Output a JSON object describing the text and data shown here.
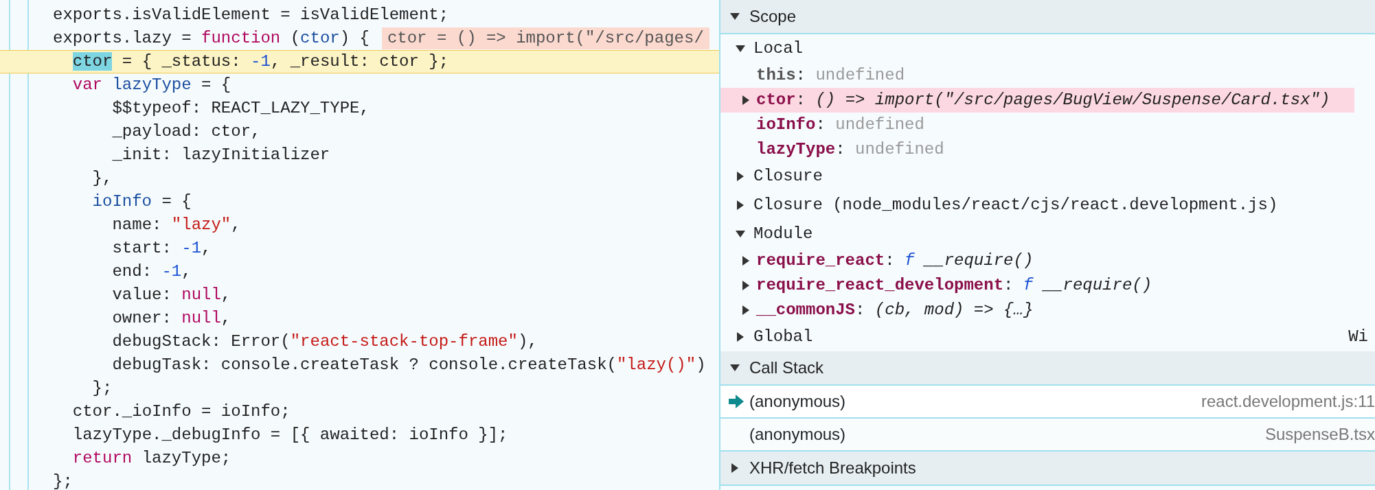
{
  "code": {
    "lines": [
      {
        "current": false,
        "segments": [
          {
            "kind": "plain",
            "text": "exports.isValidElement = isValidElement;"
          }
        ]
      },
      {
        "current": false,
        "segments": [
          {
            "kind": "plain",
            "text": "exports.lazy = "
          },
          {
            "kind": "keyword",
            "text": "function"
          },
          {
            "kind": "plain",
            "text": " ("
          },
          {
            "kind": "def",
            "text": "ctor"
          },
          {
            "kind": "plain",
            "text": ") {"
          }
        ],
        "inline_value": "ctor = () => import(\"/src/pages/"
      },
      {
        "current": true,
        "segments": [
          {
            "kind": "paused",
            "text": "  ctor"
          },
          {
            "kind": "plain",
            "text": " = { _status: "
          },
          {
            "kind": "number",
            "text": "-1"
          },
          {
            "kind": "plain",
            "text": ", _result: ctor };"
          }
        ]
      },
      {
        "current": false,
        "segments": [
          {
            "kind": "keyword",
            "text": "  var"
          },
          {
            "kind": "def",
            "text": " lazyType"
          },
          {
            "kind": "plain",
            "text": " = {"
          }
        ]
      },
      {
        "current": false,
        "segments": [
          {
            "kind": "plain",
            "text": "      $$typeof: REACT_LAZY_TYPE,"
          }
        ]
      },
      {
        "current": false,
        "segments": [
          {
            "kind": "plain",
            "text": "      _payload: ctor,"
          }
        ]
      },
      {
        "current": false,
        "segments": [
          {
            "kind": "plain",
            "text": "      _init: lazyInitializer"
          }
        ]
      },
      {
        "current": false,
        "segments": [
          {
            "kind": "plain",
            "text": "    },"
          }
        ]
      },
      {
        "current": false,
        "segments": [
          {
            "kind": "def",
            "text": "    ioInfo"
          },
          {
            "kind": "plain",
            "text": " = {"
          }
        ]
      },
      {
        "current": false,
        "segments": [
          {
            "kind": "plain",
            "text": "      name: "
          },
          {
            "kind": "string",
            "text": "\"lazy\""
          },
          {
            "kind": "plain",
            "text": ","
          }
        ]
      },
      {
        "current": false,
        "segments": [
          {
            "kind": "plain",
            "text": "      start: "
          },
          {
            "kind": "number",
            "text": "-1"
          },
          {
            "kind": "plain",
            "text": ","
          }
        ]
      },
      {
        "current": false,
        "segments": [
          {
            "kind": "plain",
            "text": "      end: "
          },
          {
            "kind": "number",
            "text": "-1"
          },
          {
            "kind": "plain",
            "text": ","
          }
        ]
      },
      {
        "current": false,
        "segments": [
          {
            "kind": "plain",
            "text": "      value: "
          },
          {
            "kind": "keyword",
            "text": "null"
          },
          {
            "kind": "plain",
            "text": ","
          }
        ]
      },
      {
        "current": false,
        "segments": [
          {
            "kind": "plain",
            "text": "      owner: "
          },
          {
            "kind": "keyword",
            "text": "null"
          },
          {
            "kind": "plain",
            "text": ","
          }
        ]
      },
      {
        "current": false,
        "segments": [
          {
            "kind": "plain",
            "text": "      debugStack: Error("
          },
          {
            "kind": "string",
            "text": "\"react-stack-top-frame\""
          },
          {
            "kind": "plain",
            "text": "),"
          }
        ]
      },
      {
        "current": false,
        "segments": [
          {
            "kind": "plain",
            "text": "      debugTask: console.createTask ? console.createTask("
          },
          {
            "kind": "string",
            "text": "\"lazy()\""
          },
          {
            "kind": "plain",
            "text": ")"
          }
        ]
      },
      {
        "current": false,
        "segments": [
          {
            "kind": "plain",
            "text": "    };"
          }
        ]
      },
      {
        "current": false,
        "segments": [
          {
            "kind": "plain",
            "text": "  ctor._ioInfo = ioInfo;"
          }
        ]
      },
      {
        "current": false,
        "segments": [
          {
            "kind": "plain",
            "text": "  lazyType._debugInfo = [{ awaited: ioInfo }];"
          }
        ]
      },
      {
        "current": false,
        "segments": [
          {
            "kind": "keyword",
            "text": "  return"
          },
          {
            "kind": "plain",
            "text": " lazyType;"
          }
        ]
      },
      {
        "current": false,
        "segments": [
          {
            "kind": "plain",
            "text": "};"
          }
        ]
      }
    ]
  },
  "scope": {
    "title": "Scope",
    "expanded": true,
    "groups": [
      {
        "label": "Local",
        "expanded": true,
        "variables": [
          {
            "kind": "receiver",
            "name": "this",
            "expandable": false,
            "highlighted": false,
            "value": [
              {
                "kind": "plain",
                "text": ":"
              },
              {
                "kind": "undefined",
                "text": " undefined"
              }
            ]
          },
          {
            "kind": "binding",
            "name": "ctor",
            "expandable": true,
            "highlighted": true,
            "value": [
              {
                "kind": "plain",
                "text": ":"
              },
              {
                "kind": "italic",
                "text": " () => import(\"/src/pages/BugView/Suspense/Card.tsx\")"
              }
            ]
          },
          {
            "kind": "binding",
            "name": "ioInfo",
            "expandable": false,
            "highlighted": false,
            "value": [
              {
                "kind": "plain",
                "text": ":"
              },
              {
                "kind": "undefined",
                "text": " undefined"
              }
            ]
          },
          {
            "kind": "binding",
            "name": "lazyType",
            "expandable": false,
            "highlighted": false,
            "value": [
              {
                "kind": "plain",
                "text": ":"
              },
              {
                "kind": "undefined",
                "text": " undefined"
              }
            ]
          }
        ]
      },
      {
        "label": "Closure",
        "expanded": false
      },
      {
        "label": "Closure (node_modules/react/cjs/react.development.js)",
        "expanded": false
      },
      {
        "label": "Module",
        "expanded": true,
        "variables": [
          {
            "kind": "binding",
            "name": "require_react",
            "expandable": true,
            "highlighted": false,
            "value": [
              {
                "kind": "plain",
                "text": ":"
              },
              {
                "kind": "fn",
                "text": " f"
              },
              {
                "kind": "italic",
                "text": " __require()"
              }
            ]
          },
          {
            "kind": "binding",
            "name": "require_react_development",
            "expandable": true,
            "highlighted": false,
            "value": [
              {
                "kind": "plain",
                "text": ":"
              },
              {
                "kind": "fn",
                "text": " f"
              },
              {
                "kind": "italic",
                "text": " __require()"
              }
            ]
          },
          {
            "kind": "binding",
            "name": "__commonJS",
            "expandable": true,
            "highlighted": false,
            "value": [
              {
                "kind": "plain",
                "text": ":"
              },
              {
                "kind": "italic",
                "text": " (cb, mod) => {…}"
              }
            ]
          }
        ]
      },
      {
        "label": "Global",
        "expanded": false,
        "value": "Wi"
      }
    ]
  },
  "call_stack": {
    "title": "Call Stack",
    "expanded": true,
    "frames": [
      {
        "function": "(anonymous)",
        "location": "react.development.js:11",
        "selected": true
      },
      {
        "function": "(anonymous)",
        "location": "SuspenseB.tsx",
        "selected": false
      }
    ]
  },
  "xhr_breakpoints": {
    "title": "XHR/fetch Breakpoints",
    "expanded": false
  }
}
